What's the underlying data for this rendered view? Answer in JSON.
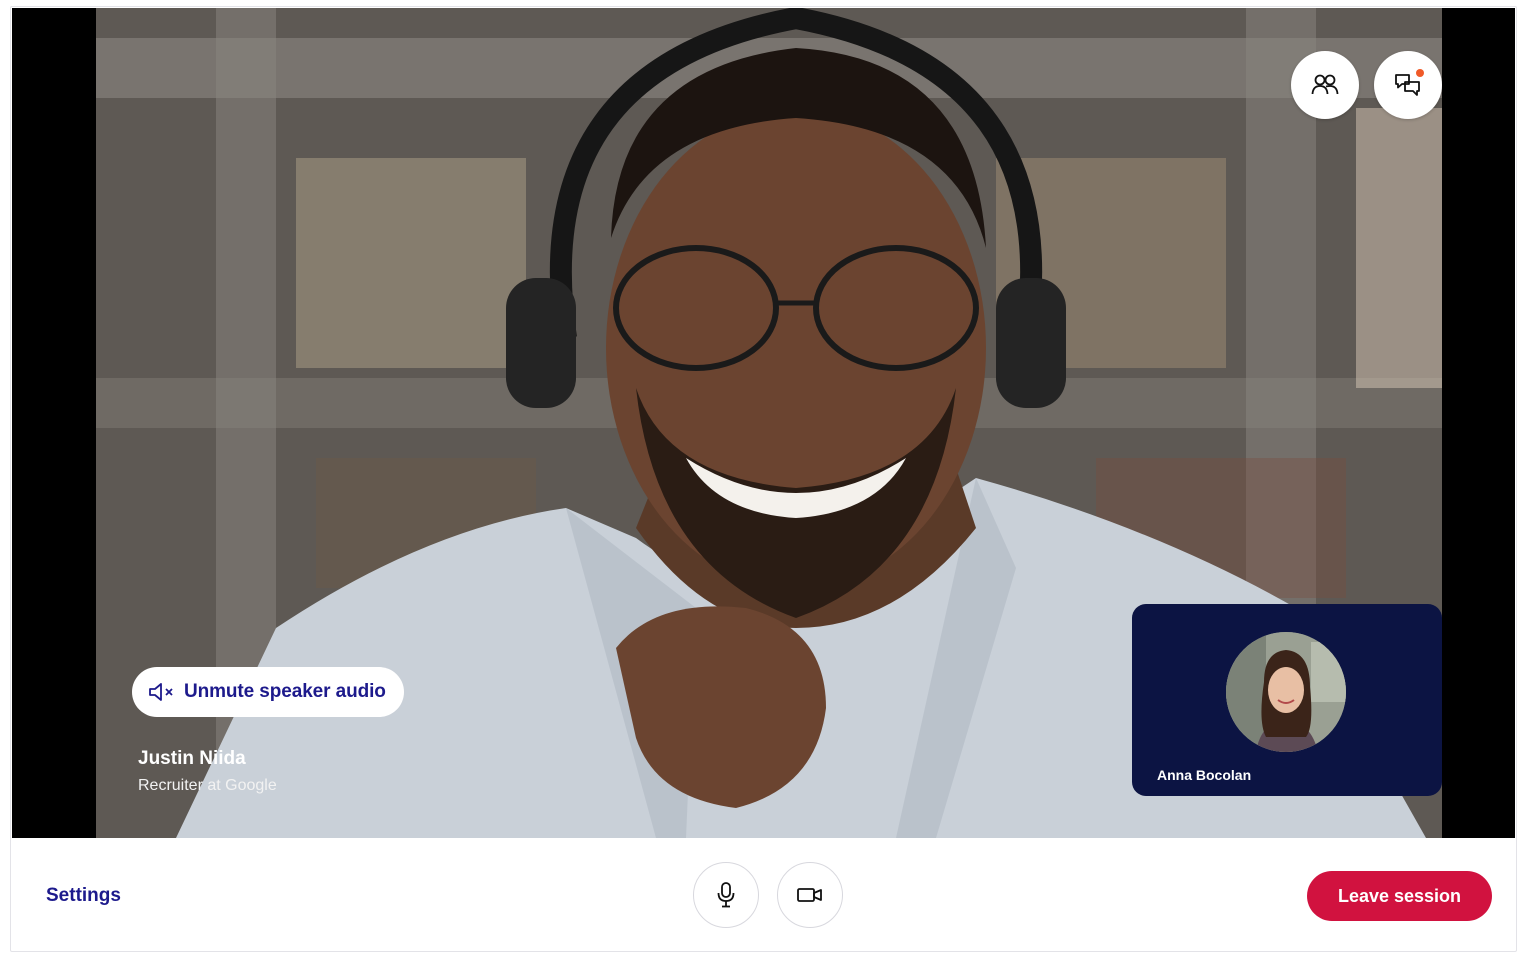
{
  "controls": {
    "unmute_label": "Unmute speaker audio",
    "settings_label": "Settings",
    "leave_label": "Leave session"
  },
  "speaker": {
    "name": "Justin Niida",
    "role": "Recruiter at Google"
  },
  "self_view": {
    "name": "Anna Bocolan"
  },
  "icons": {
    "participants": "participants-icon",
    "chat": "chat-icon",
    "speaker_muted": "speaker-muted-icon",
    "microphone": "microphone-icon",
    "camera": "camera-icon"
  },
  "colors": {
    "brand_text": "#1d1a8c",
    "leave_button": "#d1123f",
    "self_view_bg": "#0c1443",
    "notification_dot": "#f05a28"
  }
}
